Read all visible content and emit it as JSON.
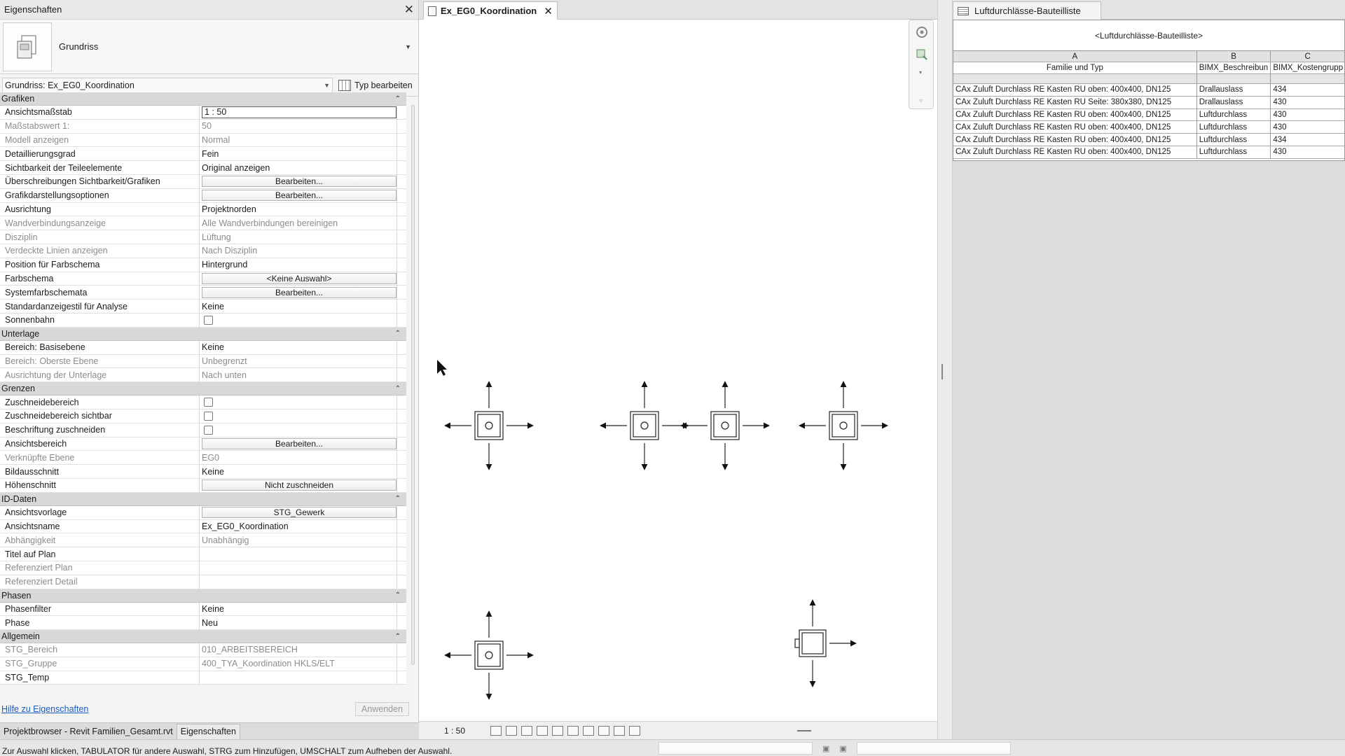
{
  "properties": {
    "title": "Eigenschaften",
    "type_name": "Grundriss",
    "view_filter": "Grundriss: Ex_EG0_Koordination",
    "edit_type_label": "Typ bearbeiten",
    "sections": {
      "grafiken": "Grafiken",
      "unterlage": "Unterlage",
      "grenzen": "Grenzen",
      "id_daten": "ID-Daten",
      "phasen": "Phasen",
      "allgemein": "Allgemein"
    },
    "rows": {
      "ansichtsmassstab": {
        "label": "Ansichtsmaßstab",
        "value": "1 : 50"
      },
      "massstabswert": {
        "label": "Maßstabswert 1:",
        "value": "50"
      },
      "modell_anzeigen": {
        "label": "Modell anzeigen",
        "value": "Normal"
      },
      "detaillierungsgrad": {
        "label": "Detaillierungsgrad",
        "value": "Fein"
      },
      "sichtbarkeit_teile": {
        "label": "Sichtbarkeit der Teileelemente",
        "value": "Original anzeigen"
      },
      "ueberschreibungen": {
        "label": "Überschreibungen Sichtbarkeit/Grafiken",
        "value": "Bearbeiten..."
      },
      "grafikdarstellung": {
        "label": "Grafikdarstellungsoptionen",
        "value": "Bearbeiten..."
      },
      "ausrichtung": {
        "label": "Ausrichtung",
        "value": "Projektnorden"
      },
      "wandverbindung": {
        "label": "Wandverbindungsanzeige",
        "value": "Alle Wandverbindungen bereinigen"
      },
      "disziplin": {
        "label": "Disziplin",
        "value": "Lüftung"
      },
      "verdeckte_linien": {
        "label": "Verdeckte Linien anzeigen",
        "value": "Nach Disziplin"
      },
      "position_farbschema": {
        "label": "Position für Farbschema",
        "value": "Hintergrund"
      },
      "farbschema": {
        "label": "Farbschema",
        "value": "<Keine Auswahl>"
      },
      "systemfarbschemata": {
        "label": "Systemfarbschemata",
        "value": "Bearbeiten..."
      },
      "standardanzeigestil": {
        "label": "Standardanzeigestil für Analyse",
        "value": "Keine"
      },
      "sonnenbahn": {
        "label": "Sonnenbahn",
        "value": ""
      },
      "bereich_basisebene": {
        "label": "Bereich: Basisebene",
        "value": "Keine"
      },
      "bereich_oberste": {
        "label": "Bereich: Oberste Ebene",
        "value": "Unbegrenzt"
      },
      "ausrichtung_unterlage": {
        "label": "Ausrichtung der Unterlage",
        "value": "Nach unten"
      },
      "zuschneidebereich": {
        "label": "Zuschneidebereich",
        "value": ""
      },
      "zuschneidebereich_sichtbar": {
        "label": "Zuschneidebereich sichtbar",
        "value": ""
      },
      "beschriftung_zuschneiden": {
        "label": "Beschriftung zuschneiden",
        "value": ""
      },
      "ansichtsbereich": {
        "label": "Ansichtsbereich",
        "value": "Bearbeiten..."
      },
      "verknuepfte_ebene": {
        "label": "Verknüpfte Ebene",
        "value": "EG0"
      },
      "bildausschnitt": {
        "label": "Bildausschnitt",
        "value": "Keine"
      },
      "hoehenschnitt": {
        "label": "Höhenschnitt",
        "value": "Nicht zuschneiden"
      },
      "ansichtsvorlage": {
        "label": "Ansichtsvorlage",
        "value": "STG_Gewerk"
      },
      "ansichtsname": {
        "label": "Ansichtsname",
        "value": "Ex_EG0_Koordination"
      },
      "abhaengigkeit": {
        "label": "Abhängigkeit",
        "value": "Unabhängig"
      },
      "titel_auf_plan": {
        "label": "Titel auf Plan",
        "value": ""
      },
      "referenziert_plan": {
        "label": "Referenziert Plan",
        "value": ""
      },
      "referenziert_detail": {
        "label": "Referenziert Detail",
        "value": ""
      },
      "phasenfilter": {
        "label": "Phasenfilter",
        "value": "Keine"
      },
      "phase": {
        "label": "Phase",
        "value": "Neu"
      },
      "stg_bereich": {
        "label": "STG_Bereich",
        "value": "010_ARBEITSBEREICH"
      },
      "stg_gruppe": {
        "label": "STG_Gruppe",
        "value": "400_TYA_Koordination HKLS/ELT"
      },
      "stg_temp": {
        "label": "STG_Temp",
        "value": ""
      }
    },
    "help_link": "Hilfe zu Eigenschaften",
    "apply_label": "Anwenden"
  },
  "bottom_tabs": [
    "Projektbrowser - Revit Familien_Gesamt.rvt",
    "Eigenschaften"
  ],
  "view": {
    "tab_label": "Ex_EG0_Koordination",
    "scale_label": "1 : 50"
  },
  "schedule": {
    "tab_label": "Luftdurchlässe-Bauteilliste",
    "title": "<Luftdurchlässe-Bauteilliste>",
    "column_letters": [
      "A",
      "B",
      "C"
    ],
    "column_headers": [
      "Familie und Typ",
      "BIMX_Beschreibun",
      "BIMX_Kostengrupp"
    ],
    "rows": [
      [
        "CAx Zuluft Durchlass RE Kasten RU oben: 400x400, DN125",
        "Drallauslass",
        "434"
      ],
      [
        "CAx Zuluft Durchlass RE Kasten RU Seite: 380x380, DN125",
        "Drallauslass",
        "430"
      ],
      [
        "CAx Zuluft Durchlass RE Kasten RU oben: 400x400, DN125",
        "Luftdurchlass",
        "430"
      ],
      [
        "CAx Zuluft Durchlass RE Kasten RU oben: 400x400, DN125",
        "Luftdurchlass",
        "430"
      ],
      [
        "CAx Zuluft Durchlass RE Kasten RU oben: 400x400, DN125",
        "Luftdurchlass",
        "434"
      ],
      [
        "CAx Zuluft Durchlass RE Kasten RU oben: 400x400, DN125",
        "Luftdurchlass",
        "430"
      ]
    ]
  },
  "status_text": "Zur Auswahl klicken, TABULATOR für andere Auswahl, STRG zum Hinzufügen, UMSCHALT zum Aufheben der Auswahl."
}
